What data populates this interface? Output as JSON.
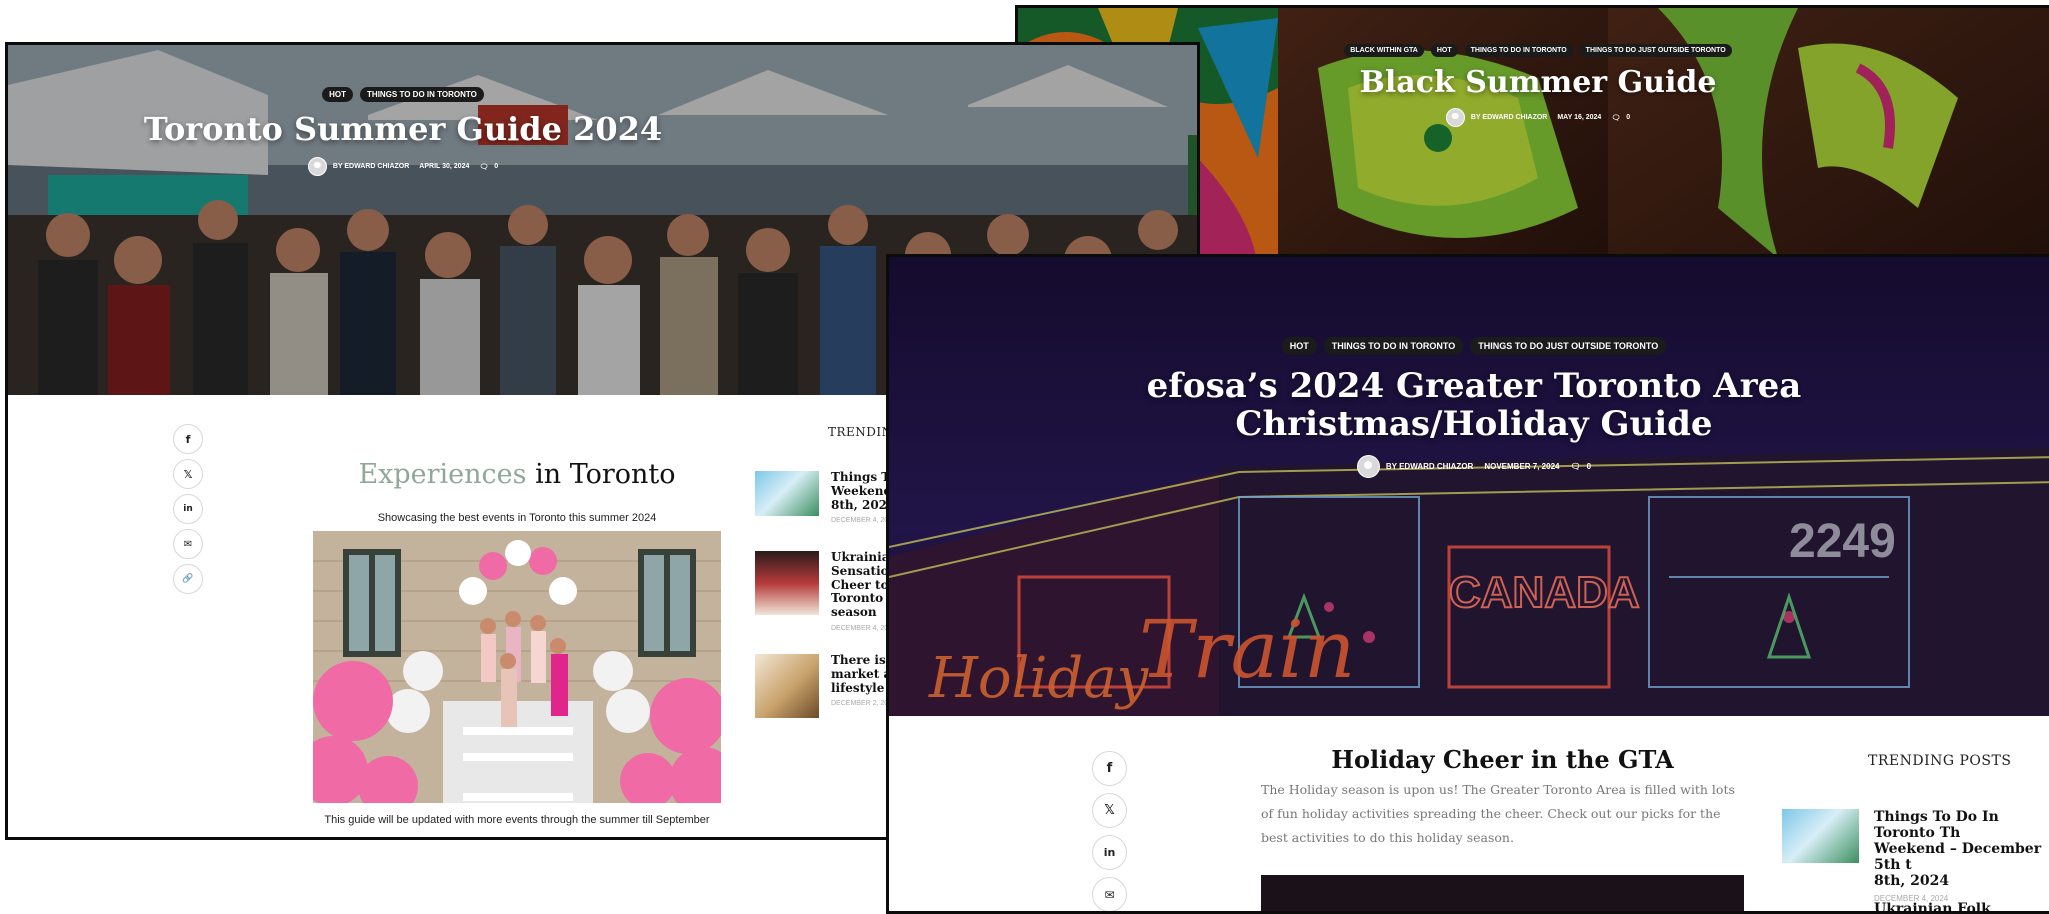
{
  "colors": {
    "accent_muted": "#8fa89a",
    "tag_bg": "#1b1b1b",
    "frame": "#0b0b0b"
  },
  "card_toronto": {
    "tags": [
      "HOT",
      "THINGS TO DO IN TORONTO"
    ],
    "title": "Toronto Summer Guide 2024",
    "author": "BY EDWARD CHIAZOR",
    "date": "APRIL 30, 2024",
    "comments": "0",
    "section_title_accent": "Experiences",
    "section_title_rest": "in Toronto",
    "subtitle": "Showcasing the best events in Toronto this summer 2024",
    "caption": "This guide will be updated with more events through the summer till September",
    "trending_label": "TRENDING",
    "trending": [
      {
        "title": "Things To\nWeekend –\n8th, 2024",
        "date": "DECEMBER 4, 20"
      },
      {
        "title": "Ukrainian\nSensation\nCheer to a\nToronto A\nseason",
        "date": "DECEMBER 4, 20"
      },
      {
        "title": "There is a\nmarket at\nlifestyle de",
        "date": "DECEMBER 2, 20"
      }
    ]
  },
  "card_black": {
    "tags": [
      "BLACK WITHIN GTA",
      "HOT",
      "THINGS TO DO IN TORONTO",
      "THINGS TO DO JUST OUTSIDE TORONTO"
    ],
    "title": "Black Summer Guide",
    "author": "BY EDWARD CHIAZOR",
    "date": "MAY 16, 2024",
    "comments": "0"
  },
  "card_holiday": {
    "tags": [
      "HOT",
      "THINGS TO DO IN TORONTO",
      "THINGS TO DO JUST OUTSIDE TORONTO"
    ],
    "title_line1": "efosa’s 2024 Greater Toronto Area",
    "title_line2": "Christmas/Holiday Guide",
    "author": "BY EDWARD CHIAZOR",
    "date": "NOVEMBER 7, 2024",
    "comments": "0",
    "section_title": "Holiday Cheer in the GTA",
    "intro": "The Holiday season is upon us! The Greater Toronto Area is filled with lots of fun holiday activities spreading the cheer. Check out our picks for the best activities to do this holiday season.",
    "trending_label": "TRENDING POSTS",
    "trending": [
      {
        "title": "Things To Do In Toronto Th\nWeekend – December 5th t\n8th, 2024",
        "date": "DECEMBER 4, 2024"
      },
      {
        "title": "Ukrainian Folk Singing Gr",
        "date": ""
      }
    ],
    "train_text": {
      "train": "Train",
      "holiday": "Holiday",
      "canada": "CANADA",
      "number": "2249"
    }
  },
  "social_icons": [
    {
      "name": "facebook-icon",
      "glyph": "f"
    },
    {
      "name": "x-twitter-icon",
      "glyph": "𝕏"
    },
    {
      "name": "linkedin-icon",
      "glyph": "in"
    },
    {
      "name": "email-icon",
      "glyph": "✉"
    },
    {
      "name": "link-icon",
      "glyph": "🔗"
    }
  ]
}
